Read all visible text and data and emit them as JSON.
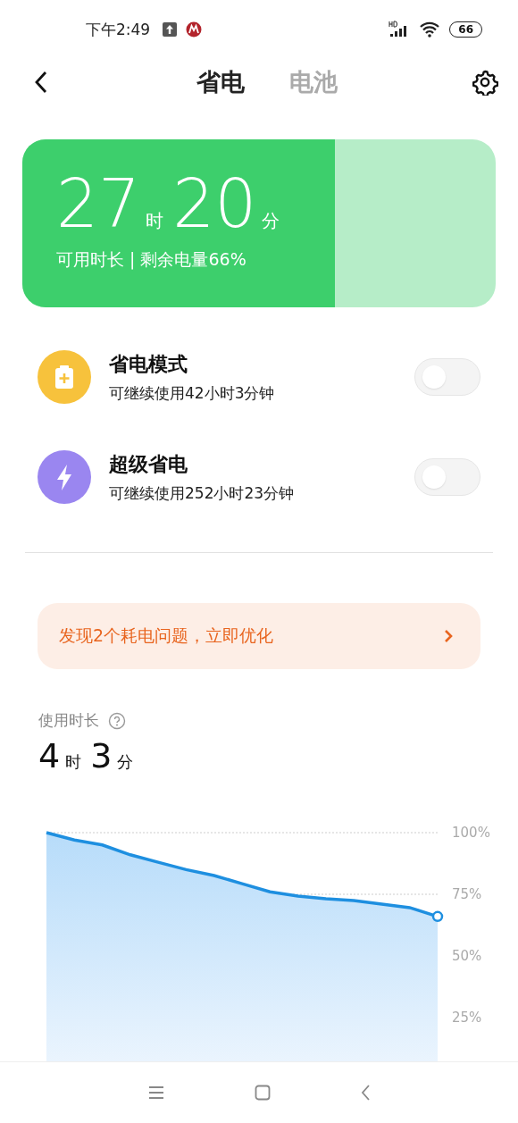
{
  "status_bar": {
    "time": "下午2:49",
    "battery": "66"
  },
  "tabs": [
    {
      "label": "省电",
      "selected": true
    },
    {
      "label": "电池",
      "selected": false
    }
  ],
  "battery_card": {
    "hours": "27",
    "hours_unit": "时",
    "minutes": "20",
    "minutes_unit": "分",
    "caption": "可用时长 | 剩余电量66%",
    "level": 0.66
  },
  "modes": [
    {
      "title": "省电模式",
      "subtitle": "可继续使用42小时3分钟",
      "kind": "battery",
      "on": false
    },
    {
      "title": "超级省电",
      "subtitle": "可继续使用252小时23分钟",
      "kind": "bolt",
      "on": false
    }
  ],
  "alert": {
    "text": "发现2个耗电问题，立即优化"
  },
  "usage": {
    "label": "使用时长",
    "hours": "4",
    "hours_unit": "时",
    "minutes": "3",
    "minutes_unit": "分",
    "chart_data": {
      "type": "area",
      "ylim": [
        0,
        100
      ],
      "yticks": [
        {
          "value": 100,
          "label": "100%"
        },
        {
          "value": 75,
          "label": "75%"
        },
        {
          "value": 50,
          "label": "50%"
        },
        {
          "value": 25,
          "label": "25%"
        }
      ],
      "series": [
        {
          "color": "#1e8fe0",
          "values": [
            100,
            97,
            95,
            91,
            88,
            85,
            82.6,
            79.3,
            76,
            74.3,
            73.2,
            72.5,
            71,
            69.6,
            66
          ]
        }
      ]
    }
  }
}
